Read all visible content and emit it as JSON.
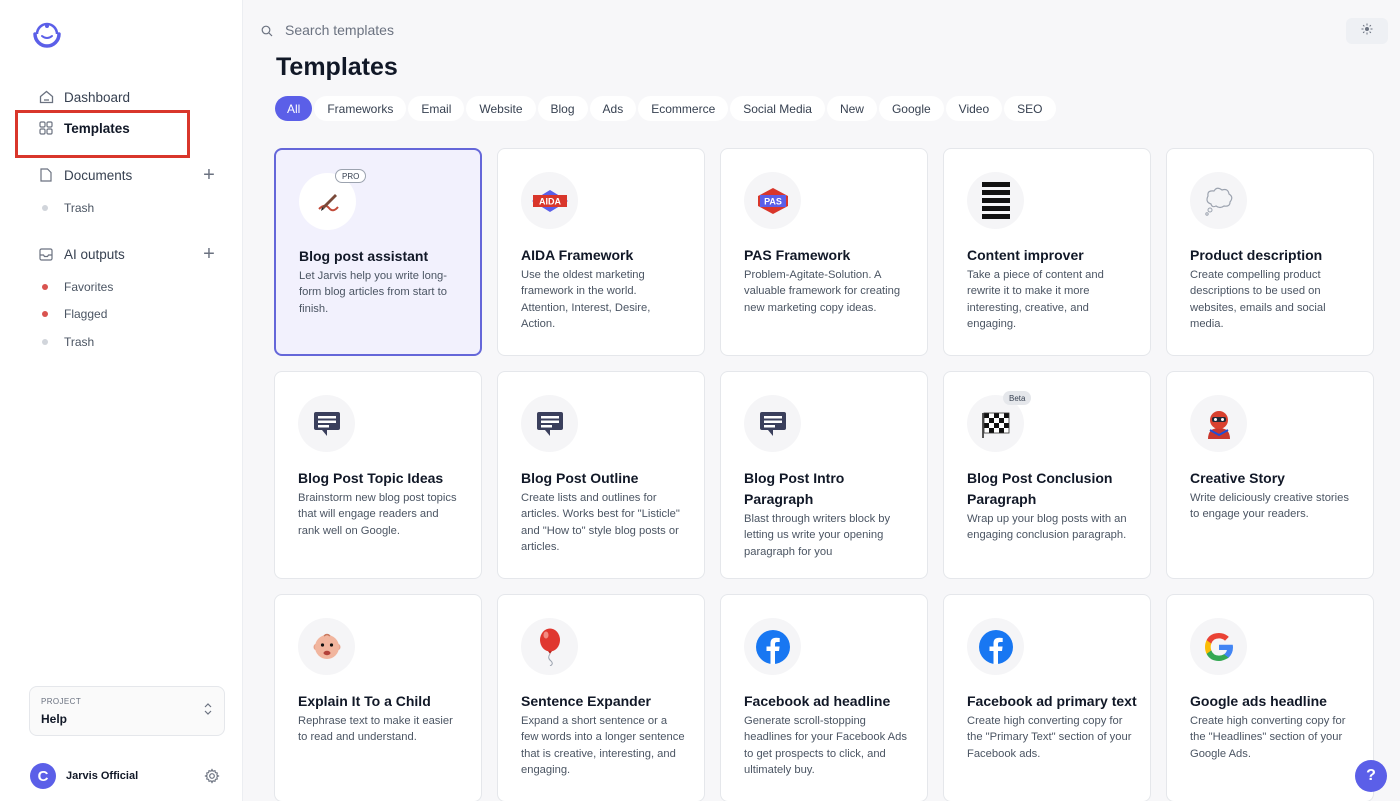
{
  "sidebar": {
    "nav": [
      {
        "label": "Dashboard",
        "icon": "home-icon"
      },
      {
        "label": "Templates",
        "icon": "grid-icon"
      },
      {
        "label": "Documents",
        "icon": "document-icon"
      },
      {
        "label": "AI outputs",
        "icon": "inbox-icon"
      }
    ],
    "documents_sub": [
      {
        "label": "Trash",
        "color": "#d1d5db"
      }
    ],
    "outputs_sub": [
      {
        "label": "Favorites",
        "color": "#d9534f"
      },
      {
        "label": "Flagged",
        "color": "#d9534f"
      },
      {
        "label": "Trash",
        "color": "#d1d5db"
      }
    ],
    "project": {
      "label": "PROJECT",
      "value": "Help"
    },
    "user": {
      "initial": "C",
      "name": "Jarvis Official"
    }
  },
  "search": {
    "placeholder": "Search templates"
  },
  "page_title": "Templates",
  "tabs": [
    "All",
    "Frameworks",
    "Email",
    "Website",
    "Blog",
    "Ads",
    "Ecommerce",
    "Social Media",
    "New",
    "Google",
    "Video",
    "SEO"
  ],
  "active_tab": "All",
  "cards": [
    {
      "title": "Blog post assistant",
      "desc": "Let Jarvis help you write long-form blog articles from start to finish.",
      "icon": "pen-writing-icon",
      "badge": "PRO"
    },
    {
      "title": "AIDA Framework",
      "desc": "Use the oldest marketing framework in the world. Attention, Interest, Desire, Action.",
      "icon": "aida-logo-icon",
      "badge": ""
    },
    {
      "title": "PAS Framework",
      "desc": "Problem-Agitate-Solution. A valuable framework for creating new marketing copy ideas.",
      "icon": "pas-logo-icon",
      "badge": ""
    },
    {
      "title": "Content improver",
      "desc": "Take a piece of content and rewrite it to make it more interesting, creative, and engaging.",
      "icon": "lines-icon",
      "badge": ""
    },
    {
      "title": "Product description",
      "desc": "Create compelling product descriptions to be used on websites, emails and social media.",
      "icon": "thought-bubble-icon",
      "badge": ""
    },
    {
      "title": "Blog Post Topic Ideas",
      "desc": "Brainstorm new blog post topics that will engage readers and rank well on Google.",
      "icon": "chat-bubble-icon",
      "badge": ""
    },
    {
      "title": "Blog Post Outline",
      "desc": "Create lists and outlines for articles. Works best for \"Listicle\" and \"How to\" style blog posts or articles.",
      "icon": "chat-bubble-icon",
      "badge": ""
    },
    {
      "title": "Blog Post Intro Paragraph",
      "desc": "Blast through writers block by letting us write your opening paragraph for you",
      "icon": "chat-bubble-icon",
      "badge": ""
    },
    {
      "title": "Blog Post Conclusion Paragraph",
      "desc": "Wrap up your blog posts with an engaging conclusion paragraph.",
      "icon": "checkered-flag-icon",
      "badge": "Beta"
    },
    {
      "title": "Creative Story",
      "desc": "Write deliciously creative stories to engage your readers.",
      "icon": "superhero-icon",
      "badge": ""
    },
    {
      "title": "Explain It To a Child",
      "desc": "Rephrase text to make it easier to read and understand.",
      "icon": "baby-face-icon",
      "badge": ""
    },
    {
      "title": "Sentence Expander",
      "desc": "Expand a short sentence or a few words into a longer sentence that is creative, interesting, and engaging.",
      "icon": "balloon-icon",
      "badge": ""
    },
    {
      "title": "Facebook ad headline",
      "desc": "Generate scroll-stopping headlines for your Facebook Ads to get prospects to click, and ultimately buy.",
      "icon": "facebook-icon",
      "badge": ""
    },
    {
      "title": "Facebook ad primary text",
      "desc": "Create high converting copy for the \"Primary Text\" section of your Facebook ads.",
      "icon": "facebook-icon",
      "badge": ""
    },
    {
      "title": "Google ads headline",
      "desc": "Create high converting copy for the \"Headlines\" section of your Google Ads.",
      "icon": "google-icon",
      "badge": ""
    }
  ],
  "help_label": "?"
}
